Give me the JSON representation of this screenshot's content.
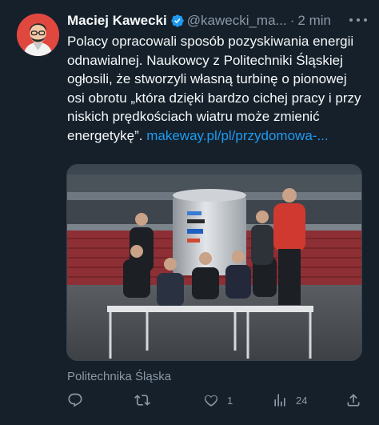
{
  "tweet": {
    "author_name": "Maciej Kawecki",
    "handle": "@kawecki_ma...",
    "separator": "·",
    "time": "2 min",
    "text": "Polacy opracowali sposób pozyskiwania energii odnawialnej. Naukowcy z Politechniki Śląskiej ogłosili, że stworzyli własną turbinę o pionowej osi obrotu „która dzięki bardzo cichej pracy i przy niskich prędkościach wiatru może zmienić energetykę”.",
    "link_text": "makeway.pl/pl/​przydomowa-...",
    "media_caption": "Politechnika Śląska",
    "icons": {
      "verified": "verified-badge-icon",
      "more": "more-icon",
      "reply": "reply-icon",
      "retweet": "retweet-icon",
      "like": "heart-icon",
      "views": "analytics-icon",
      "share": "share-icon"
    }
  },
  "actions": {
    "reply_count": "",
    "retweet_count": "",
    "like_count": "1",
    "views_count": "24"
  },
  "colors": {
    "background": "#15202b",
    "accent": "#1d9bf0",
    "muted": "#8b98a5"
  }
}
